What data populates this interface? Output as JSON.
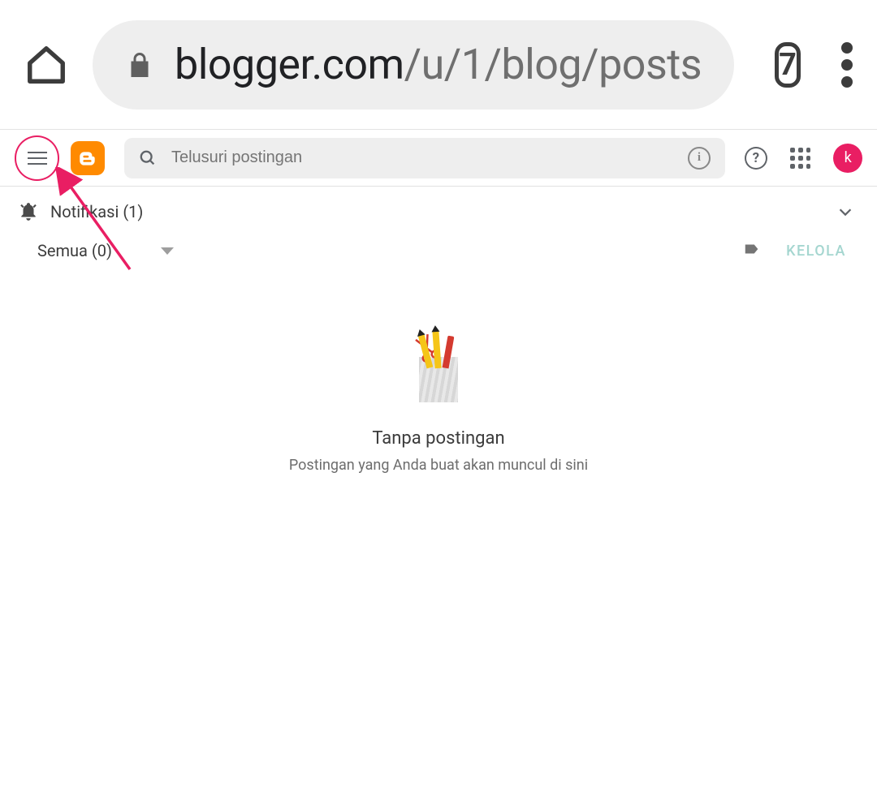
{
  "browser": {
    "url_host": "blogger.com",
    "url_path": "/u/1/blog/posts",
    "tabs_count": "7"
  },
  "app_bar": {
    "search_placeholder": "Telusuri postingan",
    "avatar_letter": "k"
  },
  "notifications": {
    "label": "Notifikasi (1)"
  },
  "filter": {
    "label": "Semua (0)",
    "manage_label": "KELOLA"
  },
  "empty_state": {
    "title": "Tanpa postingan",
    "subtitle": "Postingan yang Anda buat akan muncul di sini"
  },
  "annotation": {
    "target": "hamburger-menu"
  }
}
